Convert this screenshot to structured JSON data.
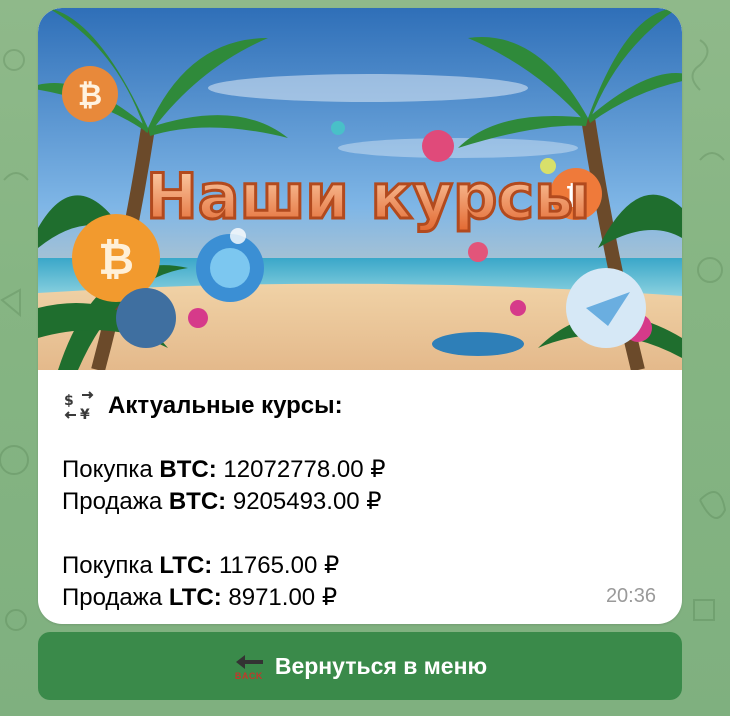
{
  "message": {
    "banner_title": "Наши курсы",
    "heading": "Актуальные курсы:",
    "heading_icon": "currency-exchange-icon",
    "rates": [
      {
        "action": "Покупка",
        "coin": "BTC:",
        "value": "12072778.00 ₽"
      },
      {
        "action": "Продажа",
        "coin": "BTC:",
        "value": "9205493.00 ₽"
      },
      {
        "action": "Покупка",
        "coin": "LTC:",
        "value": "11765.00 ₽"
      },
      {
        "action": "Продажа",
        "coin": "LTC:",
        "value": "8971.00 ₽"
      }
    ],
    "time": "20:36"
  },
  "keyboard": {
    "back_button_label": "Вернуться в меню",
    "back_icon_text": "BACK",
    "back_icon": "back-arrow-icon"
  },
  "colors": {
    "background": "#86b583",
    "bubble": "#ffffff",
    "button": "#3a8a4a",
    "timestamp": "#9a9a9a"
  }
}
